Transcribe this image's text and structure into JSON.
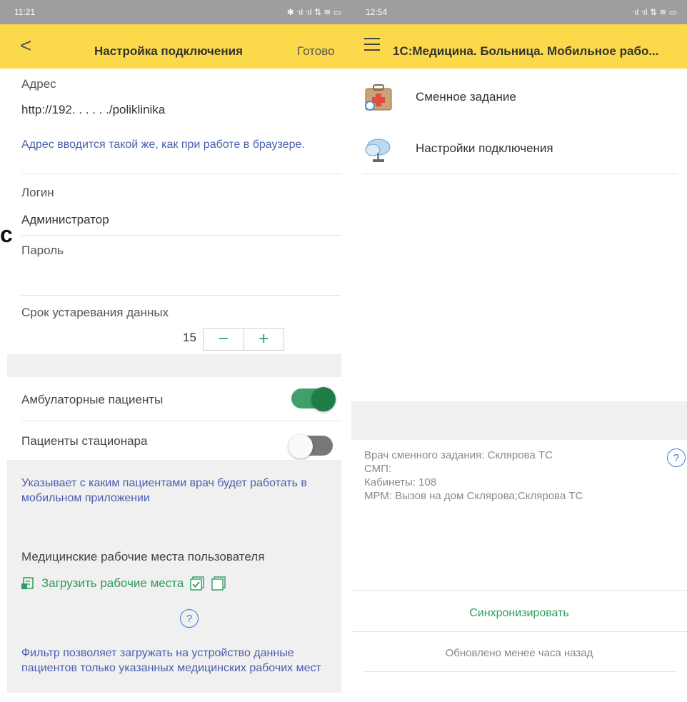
{
  "left": {
    "status": {
      "time": "11:21",
      "icons_right": "✱ ᐧıl ᐧıl ⇅ ≋ ▭"
    },
    "header": {
      "back": "<",
      "title": "Настройка подключения",
      "done": "Готово"
    },
    "address": {
      "label": "Адрес",
      "value": "http://192.  . . . . ./poliklinika",
      "hint": "Адрес вводится такой же, как при работе в браузере."
    },
    "login": {
      "label": "Логин",
      "value": "Администратор"
    },
    "password": {
      "label": "Пароль"
    },
    "expiry": {
      "label": "Срок устаревания данных",
      "value": "15",
      "minus": "−",
      "plus": "+"
    },
    "ambulatory": {
      "label": "Амбулаторные пациенты",
      "on": true
    },
    "stationary": {
      "label": "Пациенты стационара",
      "on": false
    },
    "patients_hint": "Указывает с каким пациентами врач будет работать в мобильном приложении",
    "workplaces": {
      "label": "Медицинские рабочие места пользователя",
      "load": "Загрузить рабочие места"
    },
    "help": "?",
    "filter_hint": "Фильтр позволяет загружать на устройство данные пациентов только указанных медицинских рабочих мест"
  },
  "right": {
    "status": {
      "time": "12:54",
      "icons_right": "ᐧıl ᐧıl ⇅ ≋ ▭"
    },
    "header": {
      "title": "1С:Медицина. Больница. Мобильное рабо..."
    },
    "menu": [
      {
        "label": "Сменное задание",
        "icon": "medical-kit-icon"
      },
      {
        "label": "Настройки подключения",
        "icon": "cloud-network-icon"
      }
    ],
    "info": {
      "line1": "Врач сменного задания: Склярова ТС",
      "line2": "СМП:",
      "line3": "Кабинеты: 108",
      "line4": "МРМ: Вызов на дом Склярова;Склярова ТС"
    },
    "help": "?",
    "sync": "Синхронизировать",
    "updated": "Обновлено менее часа назад"
  },
  "cut_letter": "с",
  "colors": {
    "header": "#fbd94a",
    "accent_green": "#2a9d5c",
    "hint_blue": "#4a5db0",
    "gray_bg": "#f0f0f0"
  }
}
